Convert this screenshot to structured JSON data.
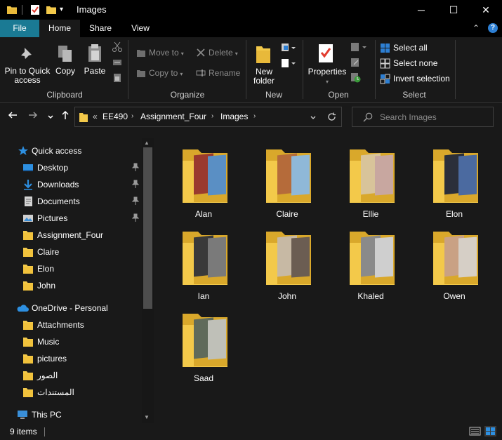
{
  "window": {
    "title": "Images",
    "controls": {
      "minimize": "─",
      "maximize": "☐",
      "close": "✕"
    }
  },
  "quick_access_toolbar": {
    "dropdown": "▾"
  },
  "ribbon_tabs": {
    "file": "File",
    "home": "Home",
    "share": "Share",
    "view": "View",
    "collapse": "⌃",
    "help": "?"
  },
  "ribbon": {
    "clipboard": {
      "label": "Clipboard",
      "pin_line1": "Pin to Quick",
      "pin_line2": "access",
      "copy": "Copy",
      "paste": "Paste"
    },
    "organize": {
      "label": "Organize",
      "move_to": "Move to",
      "copy_to": "Copy to",
      "delete": "Delete",
      "rename": "Rename"
    },
    "new": {
      "label": "New",
      "new_folder_line1": "New",
      "new_folder_line2": "folder"
    },
    "open": {
      "label": "Open",
      "properties": "Properties"
    },
    "select": {
      "label": "Select",
      "select_all": "Select all",
      "select_none": "Select none",
      "invert": "Invert selection"
    }
  },
  "address_bar": {
    "overflow": "«",
    "crumbs": [
      "EE490",
      "Assignment_Four",
      "Images"
    ],
    "search_placeholder": "Search Images"
  },
  "sidebar": {
    "quick_access": "Quick access",
    "items": [
      {
        "label": "Desktop",
        "pinned": true,
        "icon": "desktop-icon"
      },
      {
        "label": "Downloads",
        "pinned": true,
        "icon": "download-icon"
      },
      {
        "label": "Documents",
        "pinned": true,
        "icon": "documents-icon"
      },
      {
        "label": "Pictures",
        "pinned": true,
        "icon": "pictures-icon"
      },
      {
        "label": "Assignment_Four",
        "icon": "folder-icon"
      },
      {
        "label": "Claire",
        "icon": "folder-icon"
      },
      {
        "label": "Elon",
        "icon": "folder-icon"
      },
      {
        "label": "John",
        "icon": "folder-icon"
      }
    ],
    "onedrive": "OneDrive - Personal",
    "onedrive_items": [
      {
        "label": "Attachments",
        "icon": "folder-icon"
      },
      {
        "label": "Music",
        "icon": "folder-icon"
      },
      {
        "label": "pictures",
        "icon": "folder-icon"
      },
      {
        "label": "الصور",
        "icon": "folder-icon"
      },
      {
        "label": "المستندات",
        "icon": "folder-icon"
      }
    ],
    "this_pc": "This PC",
    "pin_glyph": "📌"
  },
  "files": [
    {
      "name": "Alan",
      "accent": "#9a3a2e",
      "accent2": "#5a8fc4"
    },
    {
      "name": "Claire",
      "accent": "#b56b3a",
      "accent2": "#8fb8d8"
    },
    {
      "name": "Ellie",
      "accent": "#d8c49a",
      "accent2": "#c8a7a0"
    },
    {
      "name": "Elon",
      "accent": "#2b2f3a",
      "accent2": "#4b6aa0"
    },
    {
      "name": "Ian",
      "accent": "#3a3a3a",
      "accent2": "#7a7a7a"
    },
    {
      "name": "John",
      "accent": "#c7b9a4",
      "accent2": "#6b5d52"
    },
    {
      "name": "Khaled",
      "accent": "#8a8a8a",
      "accent2": "#cfcfcf"
    },
    {
      "name": "Owen",
      "accent": "#c9a184",
      "accent2": "#d6cfc6"
    },
    {
      "name": "Saad",
      "accent": "#5f6a5a",
      "accent2": "#bfc0b8"
    }
  ],
  "status": {
    "count": "9 items"
  },
  "colors": {
    "folder": "#f3c94a",
    "folder_dark": "#d9a82b",
    "accent_tab": "#1a7a94",
    "background": "#191919"
  }
}
